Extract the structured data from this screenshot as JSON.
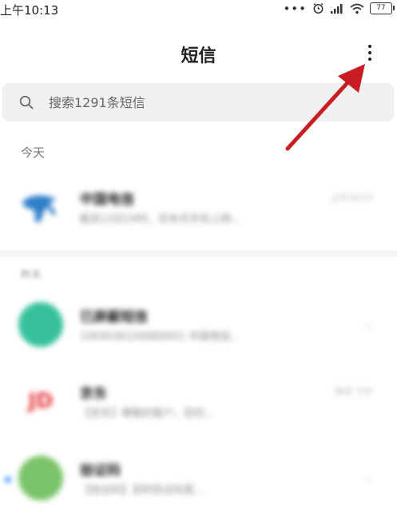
{
  "status_bar": {
    "time": "上午10:13",
    "battery": "77"
  },
  "header": {
    "title": "短信"
  },
  "search": {
    "placeholder": "搜索1291条短信"
  },
  "sections": {
    "today": "今天",
    "earlier": "昨天"
  },
  "conversations": [
    {
      "name": "中国电信",
      "snippet": "截至13日24时，您本月手机上网...",
      "time": "上午10:13",
      "avatar_color": "#2f7fc9"
    },
    {
      "name": "已屏蔽短信",
      "snippet": "1069036106880001 中国电信...",
      "time": "",
      "avatar_color": "#36c19c"
    },
    {
      "name": "京东",
      "snippet": "【京东】尊敬的客户，您的...",
      "time": "昨天 下午",
      "avatar_text": "JD",
      "avatar_color": "#e4393c"
    },
    {
      "name": "验证码",
      "snippet": "【验证码】您的验证码是...",
      "time": "",
      "avatar_color": "#7bc46a"
    }
  ],
  "colors": {
    "arrow": "#c81e23",
    "search_bg": "#f0f0f0"
  }
}
